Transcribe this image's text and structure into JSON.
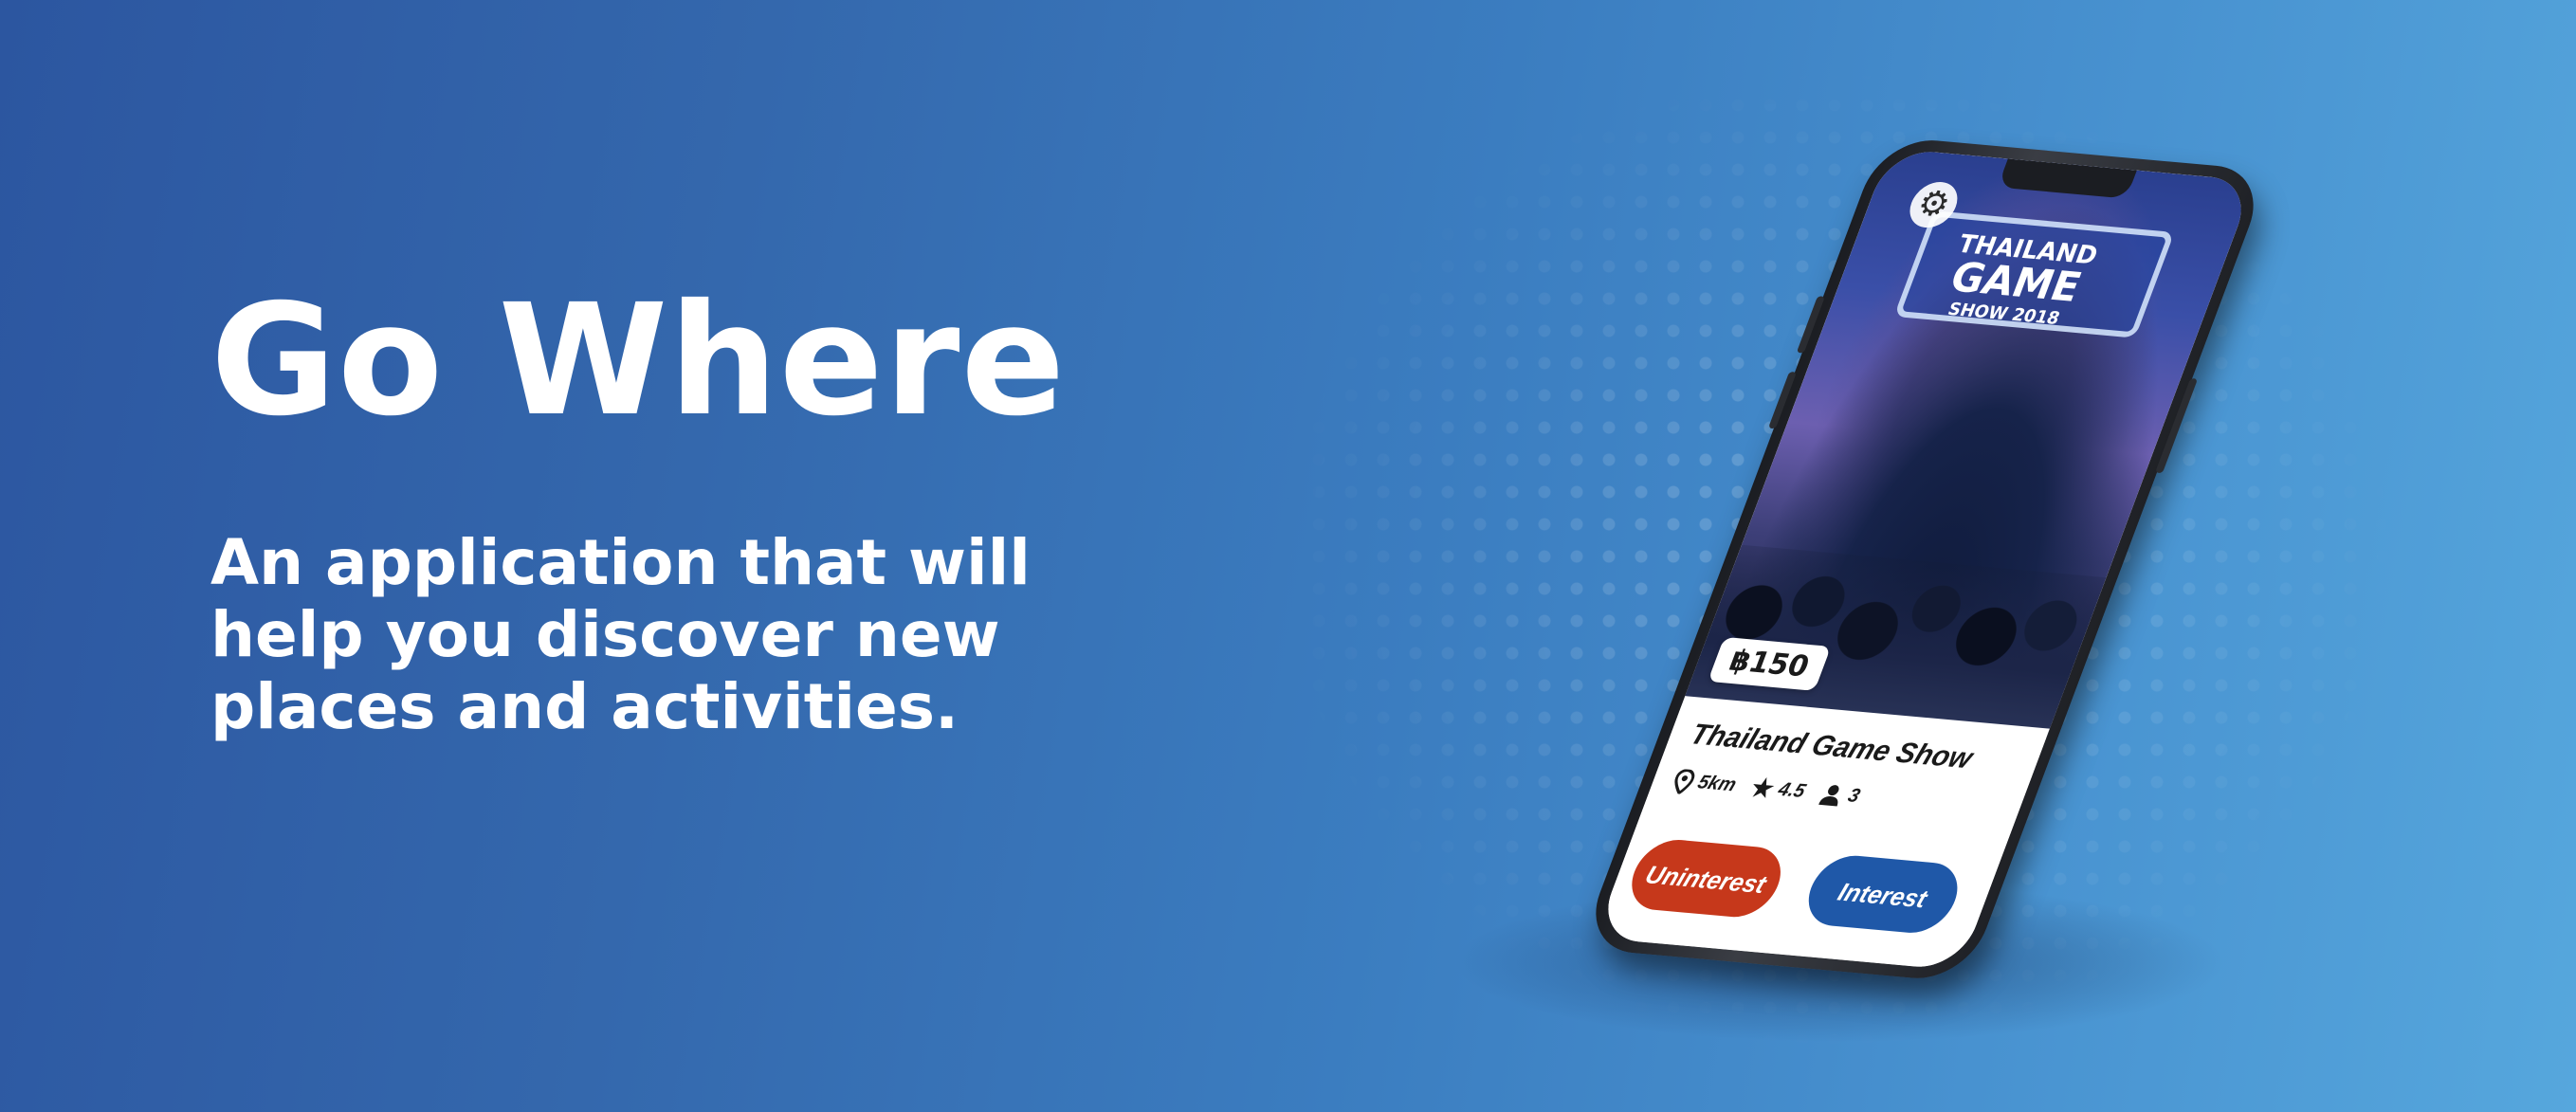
{
  "hero": {
    "title": "Go Where",
    "tagline": "An application that will help you discover new places and activities."
  },
  "phone": {
    "photo_sign": {
      "line1": "THAILAND",
      "line2": "GAME",
      "line3": "SHOW 2018"
    },
    "icons": {
      "settings": "gear-icon",
      "location": "map-pin-icon",
      "rating": "star-icon",
      "people": "person-icon"
    },
    "price": "฿150",
    "event": {
      "title": "Thailand Game Show",
      "distance": "5km",
      "rating": "4.5",
      "attendees": "3"
    },
    "buttons": {
      "uninterest": "Uninterest",
      "interest": "Interest"
    }
  },
  "colors": {
    "uninterest": "#c6381b",
    "interest": "#1f58a8",
    "background_start": "#2c56a0",
    "background_end": "#56a7dd"
  }
}
